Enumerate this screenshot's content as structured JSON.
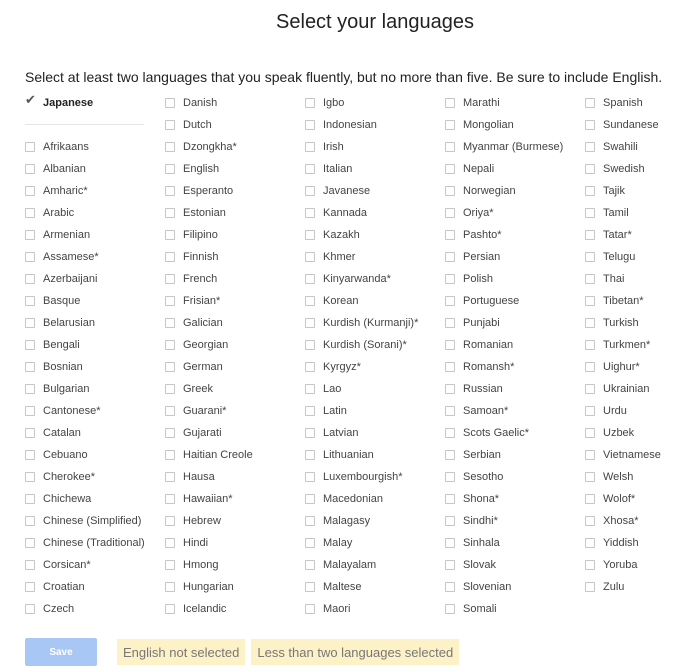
{
  "title": "Select your languages",
  "instructions": "Select at least two languages that you speak fluently, but no more than five. Be sure to include English.",
  "selected": [
    "Japanese"
  ],
  "columns": [
    [
      "Afrikaans",
      "Albanian",
      "Amharic*",
      "Arabic",
      "Armenian",
      "Assamese*",
      "Azerbaijani",
      "Basque",
      "Belarusian",
      "Bengali",
      "Bosnian",
      "Bulgarian",
      "Cantonese*",
      "Catalan",
      "Cebuano",
      "Cherokee*",
      "Chichewa",
      "Chinese (Simplified)",
      "Chinese (Traditional)",
      "Corsican*",
      "Croatian",
      "Czech"
    ],
    [
      "Danish",
      "Dutch",
      "Dzongkha*",
      "English",
      "Esperanto",
      "Estonian",
      "Filipino",
      "Finnish",
      "French",
      "Frisian*",
      "Galician",
      "Georgian",
      "German",
      "Greek",
      "Guarani*",
      "Gujarati",
      "Haitian Creole",
      "Hausa",
      "Hawaiian*",
      "Hebrew",
      "Hindi",
      "Hmong",
      "Hungarian",
      "Icelandic"
    ],
    [
      "Igbo",
      "Indonesian",
      "Irish",
      "Italian",
      "Javanese",
      "Kannada",
      "Kazakh",
      "Khmer",
      "Kinyarwanda*",
      "Korean",
      "Kurdish (Kurmanji)*",
      "Kurdish (Sorani)*",
      "Kyrgyz*",
      "Lao",
      "Latin",
      "Latvian",
      "Lithuanian",
      "Luxembourgish*",
      "Macedonian",
      "Malagasy",
      "Malay",
      "Malayalam",
      "Maltese",
      "Maori"
    ],
    [
      "Marathi",
      "Mongolian",
      "Myanmar (Burmese)",
      "Nepali",
      "Norwegian",
      "Oriya*",
      "Pashto*",
      "Persian",
      "Polish",
      "Portuguese",
      "Punjabi",
      "Romanian",
      "Romansh*",
      "Russian",
      "Samoan*",
      "Scots Gaelic*",
      "Serbian",
      "Sesotho",
      "Shona*",
      "Sindhi*",
      "Sinhala",
      "Slovak",
      "Slovenian",
      "Somali"
    ],
    [
      "Spanish",
      "Sundanese",
      "Swahili",
      "Swedish",
      "Tajik",
      "Tamil",
      "Tatar*",
      "Telugu",
      "Thai",
      "Tibetan*",
      "Turkish",
      "Turkmen*",
      "Uighur*",
      "Ukrainian",
      "Urdu",
      "Uzbek",
      "Vietnamese",
      "Welsh",
      "Wolof*",
      "Xhosa*",
      "Yiddish",
      "Yoruba",
      "Zulu"
    ]
  ],
  "save_label": "Save",
  "warnings": [
    "English not selected",
    "Less than two languages selected"
  ],
  "colors": {
    "save_button": "#a9c7f5",
    "warning_bg": "#fdf1c8"
  }
}
